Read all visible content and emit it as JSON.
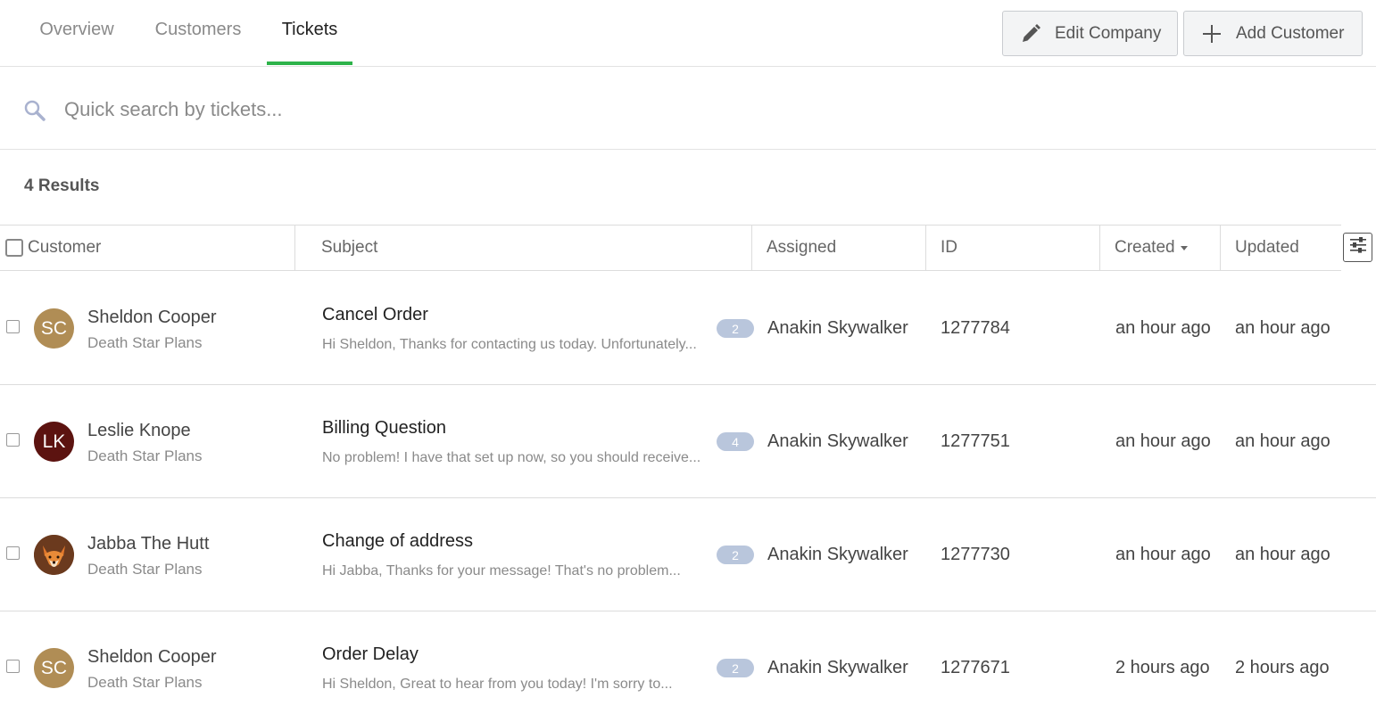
{
  "tabs": [
    {
      "label": "Overview"
    },
    {
      "label": "Customers"
    },
    {
      "label": "Tickets"
    }
  ],
  "active_tab": "Tickets",
  "accent_color": "#2db34a",
  "actions": {
    "edit_company": "Edit Company",
    "add_customer": "Add Customer"
  },
  "search": {
    "placeholder": "Quick search by tickets...",
    "value": ""
  },
  "results_label": "4 Results",
  "columns": {
    "customer": "Customer",
    "subject": "Subject",
    "assigned": "Assigned",
    "id": "ID",
    "created": "Created",
    "updated": "Updated"
  },
  "sort": {
    "column": "Created",
    "direction": "desc"
  },
  "tickets": [
    {
      "avatar_initials": "SC",
      "avatar_color": "#b08d55",
      "customer": "Sheldon Cooper",
      "company": "Death Star Plans",
      "subject": "Cancel Order",
      "preview": "Hi Sheldon, Thanks for contacting us today. Unfortunately...",
      "count": "2",
      "assigned": "Anakin Skywalker",
      "id": "1277784",
      "created": "an hour ago",
      "updated": "an hour ago"
    },
    {
      "avatar_initials": "LK",
      "avatar_color": "#5c1310",
      "customer": "Leslie Knope",
      "company": "Death Star Plans",
      "subject": "Billing Question",
      "preview": "No problem! I have that set up now, so you should receive...",
      "count": "4",
      "assigned": "Anakin Skywalker",
      "id": "1277751",
      "created": "an hour ago",
      "updated": "an hour ago"
    },
    {
      "avatar_initials": "",
      "avatar_icon": "fox-avatar-icon",
      "avatar_color": "#6b3a1e",
      "customer": "Jabba The Hutt",
      "company": "Death Star Plans",
      "subject": "Change of address",
      "preview": "Hi Jabba, Thanks for your message! That's no problem...",
      "count": "2",
      "assigned": "Anakin Skywalker",
      "id": "1277730",
      "created": "an hour ago",
      "updated": "an hour ago"
    },
    {
      "avatar_initials": "SC",
      "avatar_color": "#b08d55",
      "customer": "Sheldon Cooper",
      "company": "Death Star Plans",
      "subject": "Order Delay",
      "preview": "Hi Sheldon, Great to hear from you today! I'm sorry to...",
      "count": "2",
      "assigned": "Anakin Skywalker",
      "id": "1277671",
      "created": "2 hours ago",
      "updated": "2 hours ago"
    }
  ]
}
